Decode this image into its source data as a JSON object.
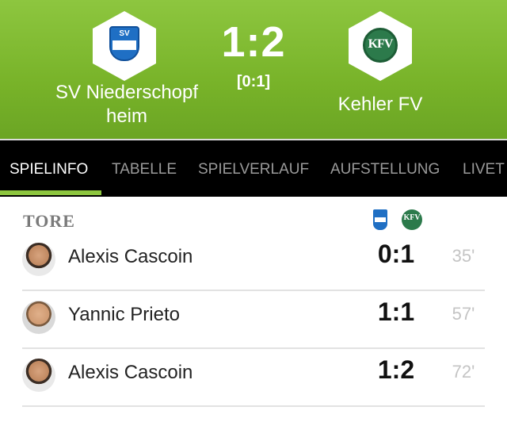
{
  "match": {
    "score": "1:2",
    "halftime": "[0:1]",
    "home_team": "SV Niederschopf",
    "home_label": "heim",
    "away_team": "Kehler FV",
    "home_crest_text": "SV",
    "away_crest_text": "KFV"
  },
  "tabs": [
    {
      "label": "SPIELINFO",
      "active": true
    },
    {
      "label": "TABELLE",
      "active": false
    },
    {
      "label": "SPIELVERLAUF",
      "active": false
    },
    {
      "label": "AUFSTELLUNG",
      "active": false
    },
    {
      "label": "LIVET",
      "active": false
    }
  ],
  "goals_section": {
    "title": "TORE",
    "home_icon": "home-team-crest-icon",
    "away_icon": "away-team-crest-icon",
    "goals": [
      {
        "player": "Alexis Cascoin",
        "score": "0:1",
        "minute": "35'"
      },
      {
        "player": "Yannic Prieto",
        "score": "1:1",
        "minute": "57'"
      },
      {
        "player": "Alexis Cascoin",
        "score": "1:2",
        "minute": "72'"
      }
    ]
  },
  "colors": {
    "accent_green": "#8dc63f",
    "tab_bar": "#000000",
    "home_blue": "#1f6fc4",
    "away_green": "#2c7a4b"
  }
}
